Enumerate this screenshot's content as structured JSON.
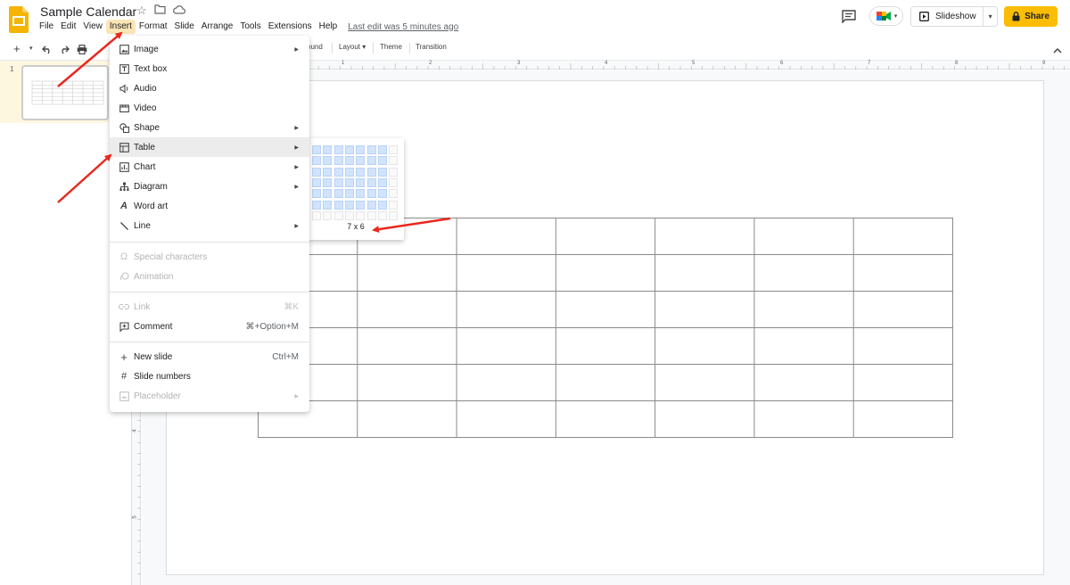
{
  "app": {
    "doc_title": "Sample Calendar",
    "last_edit": "Last edit was 5 minutes ago"
  },
  "menubar": [
    "File",
    "Edit",
    "View",
    "Insert",
    "Format",
    "Slide",
    "Arrange",
    "Tools",
    "Extensions",
    "Help"
  ],
  "header": {
    "slideshow_label": "Slideshow",
    "share_label": "Share"
  },
  "toolbar": {
    "background_label": "ound",
    "layout_label": "Layout",
    "theme_label": "Theme",
    "transition_label": "Transition"
  },
  "filmstrip": {
    "slide_number": "1"
  },
  "ruler_top": [
    "1",
    "2",
    "3",
    "4",
    "5",
    "6",
    "7",
    "8",
    "9"
  ],
  "ruler_left": [
    "4",
    "5"
  ],
  "insert_menu": {
    "items": [
      {
        "label": "Image",
        "icon": "image-icon",
        "submenu": true
      },
      {
        "label": "Text box",
        "icon": "text-box-icon"
      },
      {
        "label": "Audio",
        "icon": "audio-icon"
      },
      {
        "label": "Video",
        "icon": "video-icon"
      },
      {
        "label": "Shape",
        "icon": "shape-icon",
        "submenu": true
      },
      {
        "label": "Table",
        "icon": "table-icon",
        "submenu": true,
        "highlighted": true
      },
      {
        "label": "Chart",
        "icon": "chart-icon",
        "submenu": true
      },
      {
        "label": "Diagram",
        "icon": "diagram-icon",
        "submenu": true
      },
      {
        "label": "Word art",
        "icon": "word-art-icon"
      },
      {
        "label": "Line",
        "icon": "line-icon",
        "submenu": true
      },
      {
        "label": "Special characters",
        "icon": "omega-icon",
        "disabled": true
      },
      {
        "label": "Animation",
        "icon": "animation-icon",
        "disabled": true
      },
      {
        "label": "Link",
        "icon": "link-icon",
        "shortcut": "⌘K",
        "disabled": true
      },
      {
        "label": "Comment",
        "icon": "comment-add-icon",
        "shortcut": "⌘+Option+M"
      },
      {
        "label": "New slide",
        "icon": "plus-icon",
        "shortcut": "Ctrl+M"
      },
      {
        "label": "Slide numbers",
        "icon": "hash-icon"
      },
      {
        "label": "Placeholder",
        "icon": "placeholder-icon",
        "submenu": true,
        "disabled": true
      }
    ]
  },
  "table_grid": {
    "columns_total": 8,
    "rows_total": 7,
    "selected_columns": 7,
    "selected_rows": 6,
    "label": "7 x 6"
  },
  "colors": {
    "accent_yellow": "#fbbc04",
    "menu_active": "#fbe5b6",
    "grid_selected": "#d2e3fc",
    "annotation_red": "#e8281e"
  }
}
